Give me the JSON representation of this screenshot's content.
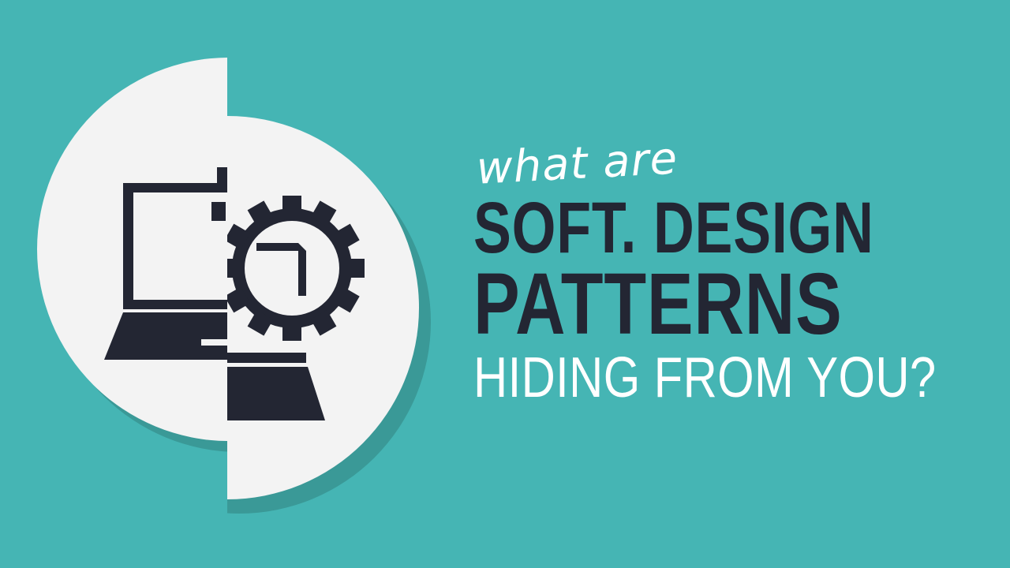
{
  "headline": {
    "line1": "what are",
    "line2": "SOFT. DESIGN",
    "line3": "PATTERNS",
    "line4": "HIDING FROM YOU?"
  },
  "illustration": {
    "icons": [
      "laptop-icon",
      "gear-icon"
    ]
  },
  "colors": {
    "background": "#45b5b4",
    "circle": "#f3f3f3",
    "shadow": "#3a9997",
    "icon": "#232633",
    "title_dark": "#232633",
    "title_light": "#ffffff"
  }
}
